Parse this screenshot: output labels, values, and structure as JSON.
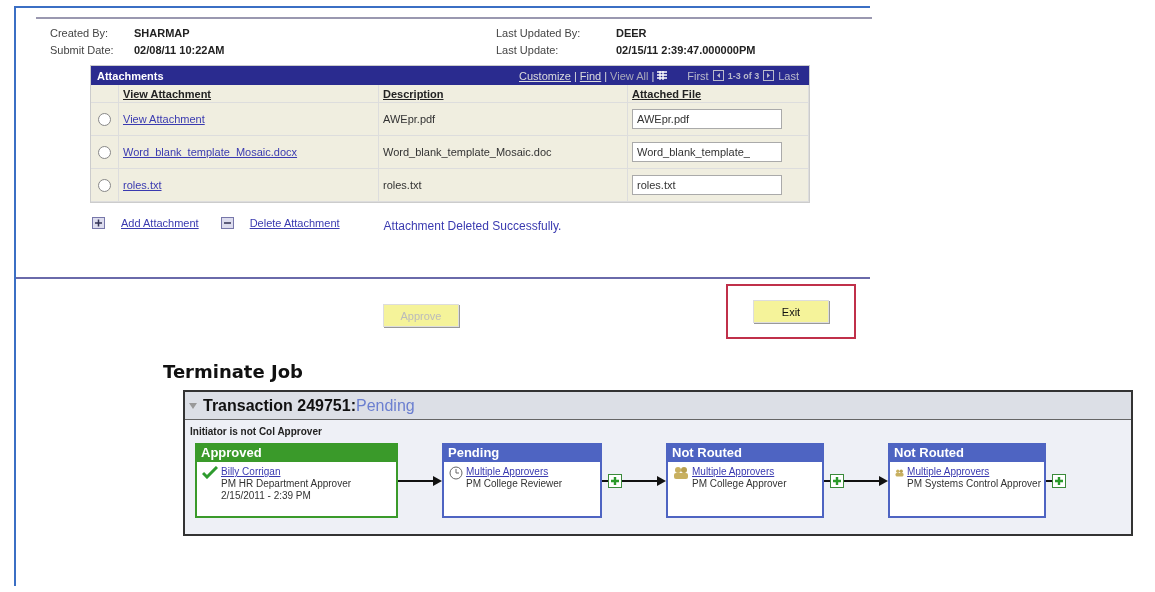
{
  "header": {
    "fields": [
      {
        "label": "Created By:",
        "value": "SHARMAP"
      },
      {
        "label": "Last Updated By:",
        "value": "DEER"
      },
      {
        "label": "Submit Date:",
        "value": "02/08/11 10:22AM"
      },
      {
        "label": "Last Update:",
        "value": "02/15/11  2:39:47.000000PM"
      }
    ]
  },
  "attachments": {
    "title": "Attachments",
    "tools": [
      "Customize",
      "Find",
      "View All"
    ],
    "separator": "|",
    "nav": {
      "first": "First",
      "range": "1-3 of 3",
      "last": "Last"
    },
    "columns": [
      "View Attachment",
      "Description",
      "Attached File"
    ],
    "rows": [
      {
        "selected": false,
        "link": "View Attachment",
        "description": "AWEpr.pdf",
        "file": "AWEpr.pdf"
      },
      {
        "selected": false,
        "link": "Word_blank_template_Mosaic.docx",
        "description": "Word_blank_template_Mosaic.doc",
        "file": "Word_blank_template_"
      },
      {
        "selected": false,
        "link": "roles.txt",
        "description": "roles.txt",
        "file": "roles.txt"
      }
    ],
    "actions": [
      {
        "kind": "add",
        "label": "Add Attachment"
      },
      {
        "kind": "delete",
        "label": "Delete Attachment"
      }
    ],
    "message": "Attachment Deleted Successfully."
  },
  "buttons": [
    {
      "label": "Approve",
      "disabled": true,
      "highlighted": false
    },
    {
      "label": "Exit",
      "disabled": false,
      "highlighted": true
    }
  ],
  "section_title": "Terminate Job",
  "transaction": {
    "title": "Transaction 249751:",
    "status": "Pending",
    "note": "Initiator is not Col Approver",
    "steps": [
      {
        "kind": "approved",
        "status": "Approved",
        "name": "Billy Corrigan",
        "role": "PM HR Department Approver",
        "date": "2/15/2011 - 2:39 PM"
      },
      {
        "kind": "pending",
        "status": "Pending",
        "name": "Multiple Approvers",
        "role": "PM College Reviewer"
      },
      {
        "kind": "not_routed",
        "status": "Not Routed",
        "name": "Multiple Approvers",
        "role": "PM College Approver"
      },
      {
        "kind": "not_routed",
        "status": "Not Routed",
        "name": "Multiple Approvers",
        "role": "PM Systems Control Approver"
      }
    ],
    "links": [
      {
        "kind": "arrow"
      },
      {
        "kind": "plus_arrow"
      },
      {
        "kind": "plus_arrow"
      },
      {
        "kind": "plus"
      }
    ]
  }
}
